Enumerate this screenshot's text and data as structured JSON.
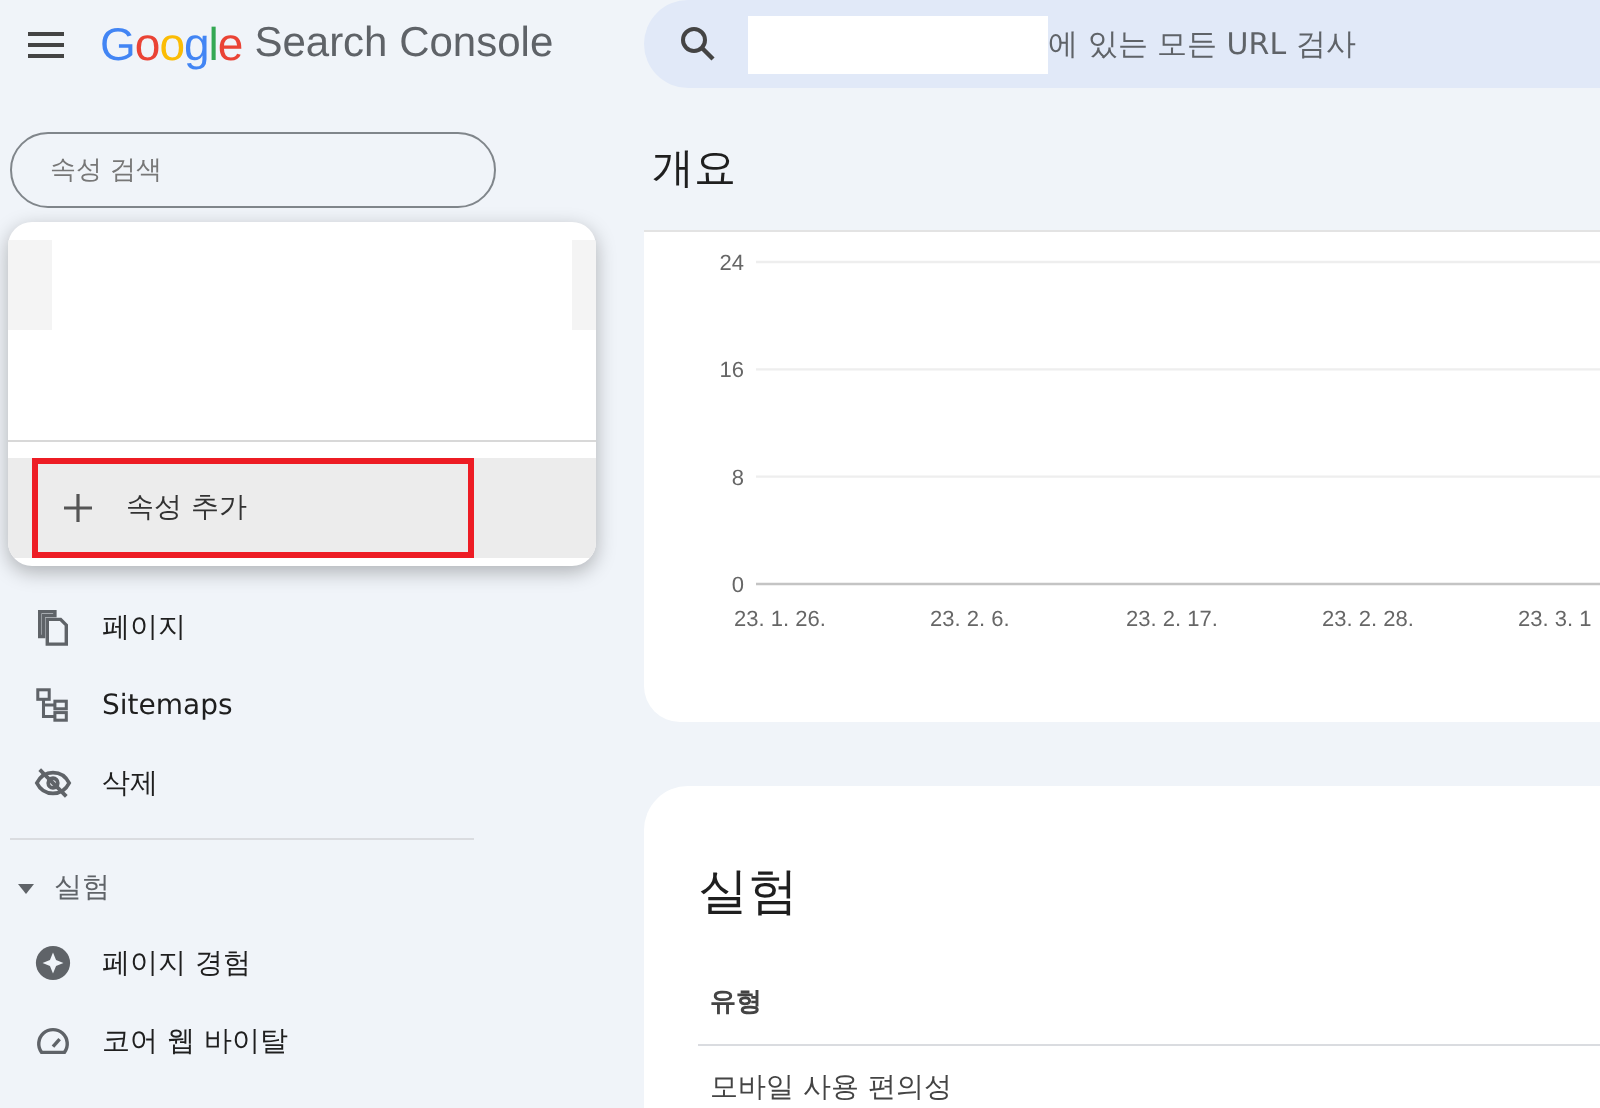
{
  "header": {
    "logo": "Google",
    "product": "Search Console",
    "search": {
      "placeholder": "에 있는 모든 URL 검사"
    }
  },
  "sidebar": {
    "property_search": {
      "placeholder": "속성 검색"
    },
    "items": [
      {
        "label": "페이지",
        "kind": "pages"
      },
      {
        "label": "Sitemaps",
        "kind": "sitemap"
      },
      {
        "label": "삭제",
        "kind": "removal"
      }
    ],
    "sections": [
      {
        "label": "실험",
        "expanded": true,
        "items": [
          {
            "label": "페이지 경험",
            "kind": "experience"
          },
          {
            "label": "코어 웹 바이탈",
            "kind": "vitals"
          }
        ]
      }
    ]
  },
  "property_menu": {
    "add_button": {
      "label": "속성 추가",
      "highlighted": true
    }
  },
  "overview": {
    "title": "개요",
    "chart_data": {
      "type": "line",
      "categories": [
        "23. 1. 26.",
        "23. 2. 6.",
        "23. 2. 17.",
        "23. 2. 28.",
        "23. 3. 1"
      ],
      "ylim": [
        0,
        24
      ],
      "yticks": [
        0,
        8,
        16,
        24
      ]
    }
  },
  "experiments": {
    "title": "실험",
    "table": {
      "columns": [
        "유형"
      ],
      "rows": [
        [
          "모바일 사용 편의성"
        ]
      ]
    }
  }
}
